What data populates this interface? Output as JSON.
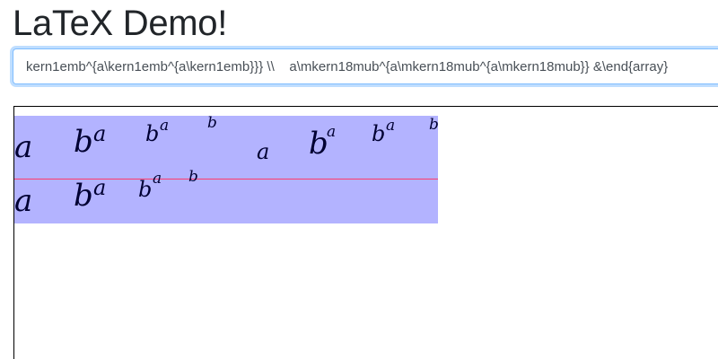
{
  "page": {
    "title": "LaTeX Demo!"
  },
  "editor": {
    "value": "kern1emb^{a\\kern1emb^{a\\kern1emb}}} \\\\    a\\mkern18mub^{a\\mkern18mub^{a\\mkern18mub}} &\\end{array}"
  },
  "render": {
    "highlight_color": "#b3b3ff",
    "baseline_color": "#ff3b6b",
    "row1": {
      "g1": "a",
      "g2": "b",
      "g3": "a",
      "g4": "b",
      "g5": "a",
      "g6": "b",
      "g7": "a",
      "g8": "b",
      "g9": "a",
      "g10": "b",
      "g11": "a",
      "g12": "b"
    },
    "row2": {
      "g1": "a",
      "g2": "b",
      "g3": "a",
      "g4": "b",
      "g5": "a",
      "g6": "b"
    }
  }
}
